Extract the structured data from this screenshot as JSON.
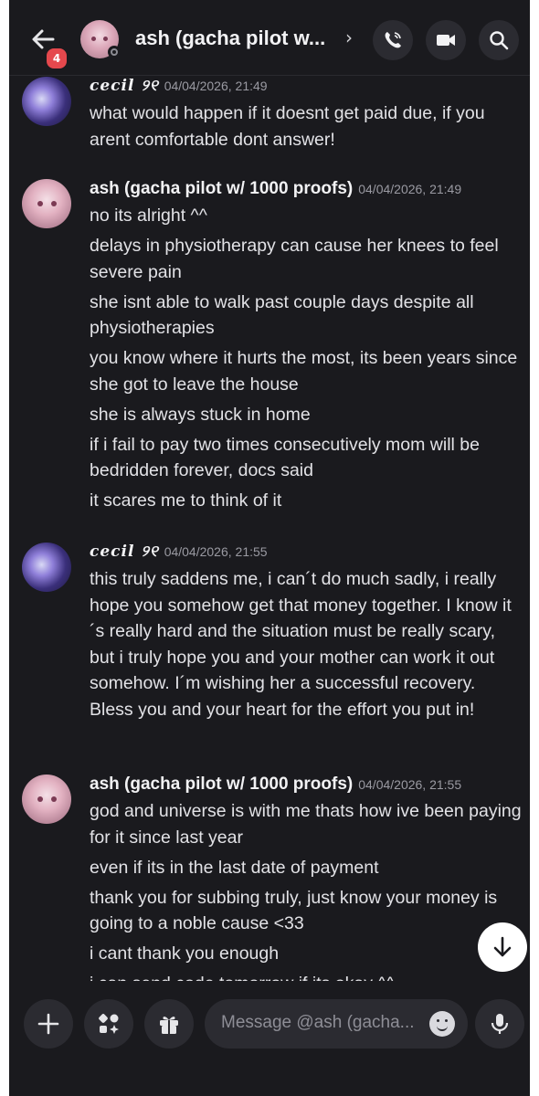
{
  "header": {
    "title": "ash (gacha pilot w...",
    "back_badge": "4"
  },
  "messages": [
    {
      "author": "cecil ୨୧",
      "timestamp": "04/04/2026, 21:49",
      "lines": [
        "what would happen if it doesnt get paid due, if you arent comfortable dont answer!"
      ]
    },
    {
      "author": "ash (gacha pilot w/ 1000 proofs)",
      "timestamp": "04/04/2026, 21:49",
      "lines": [
        "no its alright ^^",
        "delays in physiotherapy can cause her knees to feel severe pain",
        "she isnt able to walk past couple days despite all physiotherapies",
        "you know where it hurts the most, its been years since she got to leave the house",
        "she is always stuck in home",
        "if i fail to pay two times consecutively mom will be bedridden forever, docs said",
        "it scares me to think of it"
      ]
    },
    {
      "author": "cecil ୨୧",
      "timestamp": "04/04/2026, 21:55",
      "lines": [
        "this truly saddens me, i can´t do much sadly, i really hope you somehow get that money together. I know it´s really hard and the situation must be really scary, but i truly hope you and your mother can work it out somehow. I´m wishing her a successful recovery. Bless you and your heart for the effort you put in!"
      ]
    },
    {
      "author": "ash (gacha pilot w/ 1000 proofs)",
      "timestamp": "04/04/2026, 21:55",
      "lines": [
        "god and universe is with me thats how ive been paying for it since last year",
        "even if its in the last date of payment",
        "thank you for subbing truly, just know your money is going to a noble cause <33",
        "i cant thank you enough",
        "i can send code tomorrow if its okay ^^"
      ]
    }
  ],
  "composer": {
    "placeholder": "Message @ash (gacha..."
  },
  "icons": {
    "back": "arrow-left-icon",
    "call": "phone-icon",
    "video": "video-camera-icon",
    "search": "search-icon",
    "jump": "arrow-down-icon",
    "add": "plus-icon",
    "apps": "apps-icon",
    "gift": "gift-icon",
    "emoji": "emoji-icon",
    "mic": "microphone-icon"
  },
  "colors": {
    "background": "#1a1a1e",
    "badge": "#e5484d",
    "button": "#2b2b31",
    "text": "#e2e2e6",
    "muted": "#9a9aa2"
  }
}
